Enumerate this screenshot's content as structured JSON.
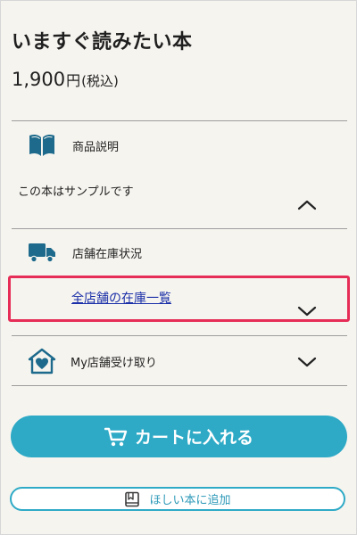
{
  "product": {
    "title": "いますぐ読みたい本",
    "price": "1,900",
    "price_unit": "円",
    "price_note": "(税込)"
  },
  "sections": {
    "description": {
      "label": "商品説明",
      "text": "この本はサンプルです",
      "icon": "open-book-icon",
      "expanded": true
    },
    "stock": {
      "label": "店舗在庫状況",
      "link_text": "全店舗の在庫一覧",
      "icon": "delivery-truck-icon",
      "expanded": false
    },
    "my_store": {
      "label": "My店舗受け取り",
      "icon": "house-heart-icon",
      "expanded": false
    }
  },
  "actions": {
    "cart_label": "カートに入れる",
    "cart_icon": "cart-icon",
    "wishlist_label": "ほしい本に追加",
    "wishlist_icon": "book-bookmark-icon"
  },
  "colors": {
    "accent": "#2eaac6",
    "icon_blue": "#1d6a8c",
    "highlight": "#e62d57",
    "link": "#1a2fa8",
    "background": "#f6f4ef"
  }
}
